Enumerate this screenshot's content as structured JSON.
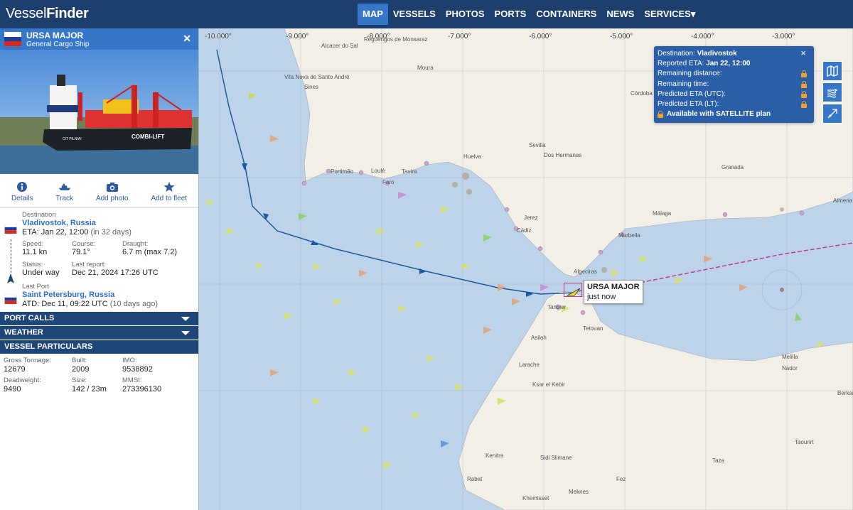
{
  "brand": {
    "part1": "Vessel",
    "part2": "Finder"
  },
  "nav": [
    {
      "label": "MAP",
      "active": true
    },
    {
      "label": "VESSELS"
    },
    {
      "label": "PHOTOS"
    },
    {
      "label": "PORTS"
    },
    {
      "label": "CONTAINERS"
    },
    {
      "label": "NEWS"
    },
    {
      "label": "SERVICES▾"
    }
  ],
  "vessel": {
    "name": "URSA MAJOR",
    "type": "General Cargo Ship",
    "flag": "Russia",
    "photo_text": {
      "bow_name": "CIT PILNIAI",
      "hull_text": "COMBI-LIFT"
    },
    "actions": [
      {
        "label": "Details",
        "icon": "info-icon"
      },
      {
        "label": "Track",
        "icon": "ship-icon"
      },
      {
        "label": "Add photo",
        "icon": "camera-icon"
      },
      {
        "label": "Add to fleet",
        "icon": "star-icon"
      }
    ],
    "destination_label": "Destination",
    "destination": "Vladivostok, Russia",
    "eta_label": "ETA:",
    "eta": "Jan 22, 12:00",
    "eta_rel": "(in 32 days)",
    "speed_label": "Speed:",
    "speed": "11.1 kn",
    "course_label": "Course:",
    "course": "79.1°",
    "draught_label": "Draught:",
    "draught": "6.7 m (max 7.2)",
    "status_label": "Status:",
    "status": "Under way",
    "last_report_label": "Last report:",
    "last_report": "Dec 21, 2024 17:26 UTC",
    "last_port_label": "Last Port",
    "last_port": "Saint Petersburg, Russia",
    "atd_label": "ATD:",
    "atd": "Dec 11, 09:22 UTC",
    "atd_rel": "(10 days ago)"
  },
  "sections": {
    "port_calls": "PORT CALLS",
    "weather": "WEATHER",
    "particulars": "VESSEL PARTICULARS"
  },
  "particulars": {
    "gt_label": "Gross Tonnage:",
    "gt": "12679",
    "built_label": "Built:",
    "built": "2009",
    "imo_label": "IMO:",
    "imo": "9538892",
    "dwt_label": "Deadweight:",
    "dwt": "9490",
    "size_label": "Size:",
    "size": "142 / 23m",
    "mmsi_label": "MMSI:",
    "mmsi": "273396130"
  },
  "eta_popup": {
    "dest_label": "Destination:",
    "dest": "Vladivostok",
    "reported_label": "Reported ETA:",
    "reported": "Jan 22, 12:00",
    "rows": [
      "Remaining distance:",
      "Remaining time:",
      "Predicted ETA (UTC):",
      "Predicted ETA (LT):"
    ],
    "satellite": "Available with SATELLITE plan",
    "close": "×"
  },
  "map_label": {
    "name": "URSA MAJOR",
    "time": "just now"
  },
  "longitudes": [
    "-10.000°",
    "-9.000°",
    "-8.000°",
    "-7.000°",
    "-6.000°",
    "-5.000°",
    "-4.000°",
    "-3.000°"
  ],
  "places": [
    "Alcacer do Sal",
    "Reguengos de Monsaraz",
    "Moura",
    "Vila Nova de Santo André",
    "Sines",
    "Córdoba",
    "Sevilla",
    "Dos Hermanas",
    "Huelva",
    "Portimão",
    "Loulé",
    "Tavira",
    "Faro",
    "Granada",
    "Málaga",
    "Almeria",
    "Jerez",
    "Cádiz",
    "Marbella",
    "Algeciras",
    "Tangier",
    "Tetouan",
    "Asilah",
    "Larache",
    "Ksar el Kebir",
    "Kenitra",
    "Sidi Slimane",
    "Rabat",
    "Khemisset",
    "Meknes",
    "Fez",
    "Taza",
    "Taourirt",
    "Berkane",
    "Nador",
    "Melilla"
  ],
  "colors": {
    "nav": "#1d3f6e",
    "accent": "#3777c9",
    "section": "#1e4678",
    "sea": "#bcd3ea",
    "land": "#f1efe6",
    "track": "#1b5b9c"
  }
}
